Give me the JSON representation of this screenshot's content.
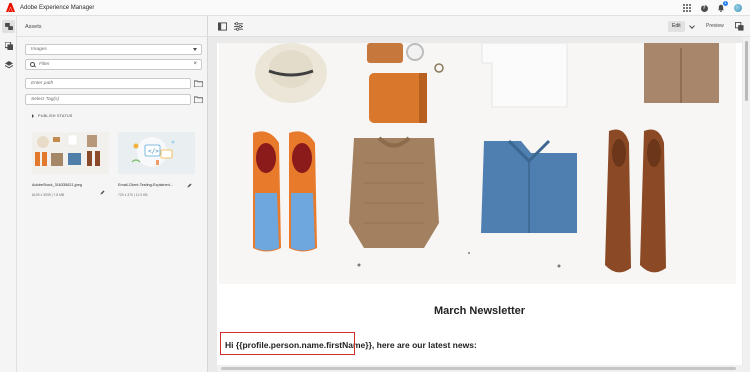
{
  "app": {
    "title": "Adobe Experience Manager",
    "brand_color": "#eb1000",
    "notification_count": "1"
  },
  "rail": {
    "items": [
      "assets-icon",
      "components-icon",
      "layers-icon"
    ]
  },
  "panel": {
    "title": "Assets",
    "type_select": {
      "value": "Images"
    },
    "filter": {
      "placeholder": "Filter"
    },
    "path": {
      "placeholder": "Enter path"
    },
    "tags": {
      "placeholder": "Select Tag(s)"
    },
    "publish_status_label": "PUBLISH STATUS",
    "assets": [
      {
        "name": "AdobeStock_316335621.jpeg",
        "meta": "6109 x 3939 | 7.8 MB"
      },
      {
        "name": "Email-Client-Testing-Explained...",
        "meta": "720 x 370 | 11.0 KB"
      }
    ]
  },
  "editor": {
    "toolbar": {
      "edit_label": "Edit",
      "preview_label": "Preview"
    },
    "email": {
      "headline": "March Newsletter",
      "greeting": "Hi {{profile.person.name.firstName}}, here are our latest news:",
      "highlight_color": "#d0302a"
    }
  }
}
